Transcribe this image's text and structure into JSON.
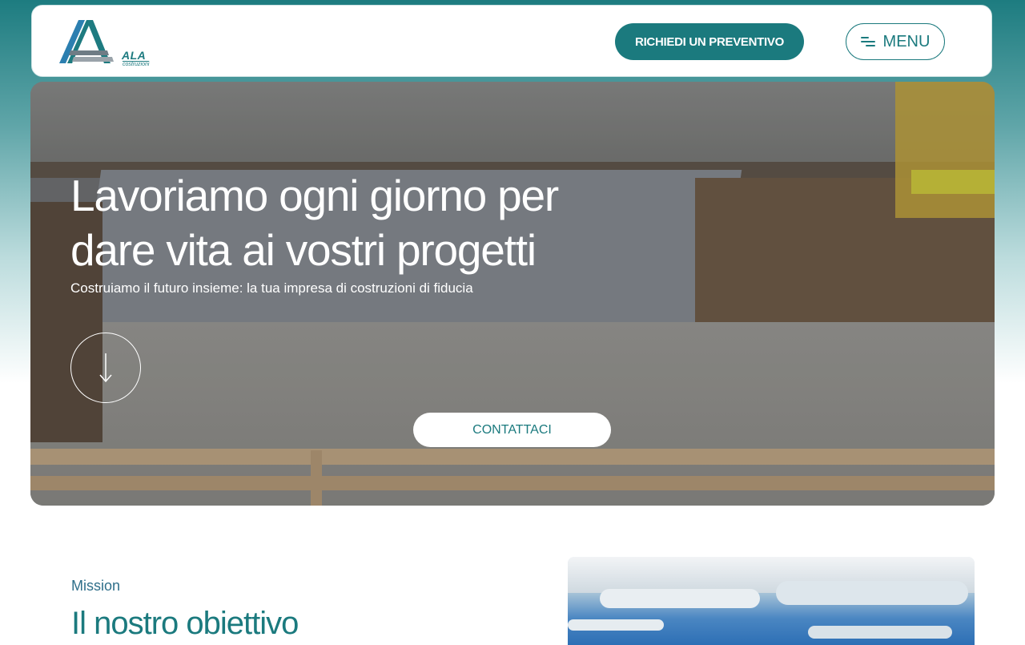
{
  "header": {
    "logo_name": "ALA",
    "logo_sub": "costruzioni",
    "quote_button": "RICHIEDI UN PREVENTIVO",
    "menu_button": "MENU"
  },
  "hero": {
    "title": "Lavoriamo ogni giorno per dare vita ai vostri progetti",
    "subtitle": "Costruiamo il futuro insieme: la tua impresa di costruzioni di fiducia",
    "contact_button": "CONTATTACI"
  },
  "mission": {
    "label": "Mission",
    "title": "Il nostro obiettivo"
  },
  "colors": {
    "brand": "#1b7a7e",
    "brand_light": "#5fa5a8"
  },
  "icons": [
    "menu-lines-icon",
    "arrow-down-icon"
  ]
}
